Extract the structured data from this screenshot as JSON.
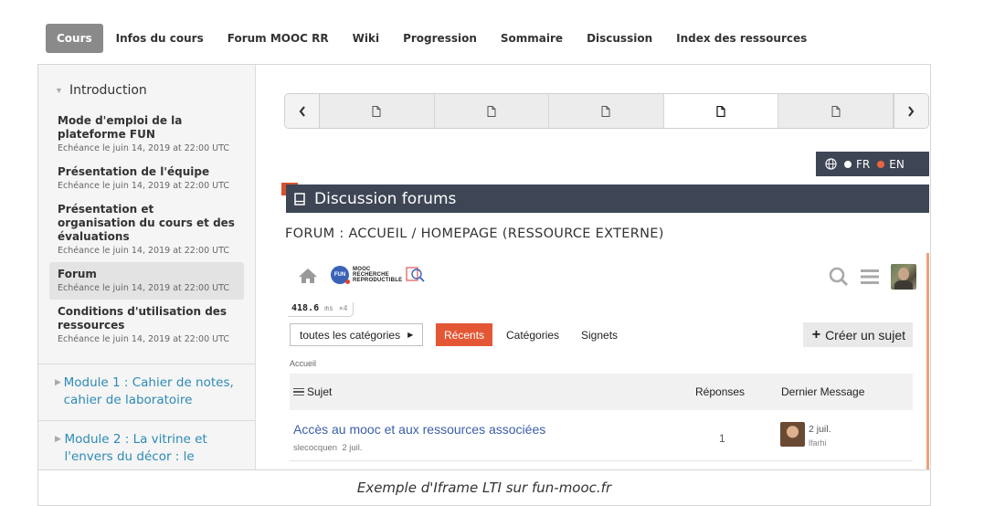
{
  "nav": {
    "tabs": [
      {
        "label": "Cours"
      },
      {
        "label": "Infos du cours"
      },
      {
        "label": "Forum MOOC RR"
      },
      {
        "label": "Wiki"
      },
      {
        "label": "Progression"
      },
      {
        "label": "Sommaire"
      },
      {
        "label": "Discussion"
      },
      {
        "label": "Index des ressources"
      }
    ],
    "active_tab": "Cours"
  },
  "sidebar": {
    "chapter": "Introduction",
    "sequences": [
      {
        "name": "Mode d'emploi de la plateforme FUN",
        "due": "Echéance le juin 14, 2019 at 22:00 UTC"
      },
      {
        "name": "Présentation de l'équipe",
        "due": "Echéance le juin 14, 2019 at 22:00 UTC"
      },
      {
        "name": "Présentation et organisation du cours et des évaluations",
        "due": "Echéance le juin 14, 2019 at 22:00 UTC"
      },
      {
        "name": "Forum",
        "due": "Echéance le juin 14, 2019 at 22:00 UTC"
      },
      {
        "name": "Conditions d'utilisation des ressources",
        "due": "Echéance le juin 14, 2019 at 22:00 UTC"
      }
    ],
    "active_sequence": "Forum",
    "modules": [
      {
        "title": "Module 1 : Cahier de notes, cahier de laboratoire"
      },
      {
        "title": "Module 2 : La vitrine et l'envers du décor : le"
      }
    ]
  },
  "sequence_nav": {
    "unit_count": 5,
    "current_unit": 4
  },
  "language": {
    "fr": "FR",
    "en": "EN",
    "selected": "EN",
    "colors": {
      "bar": "#3e4655",
      "fr_dot": "#ffffff",
      "en_dot": "#e8663f"
    }
  },
  "unit": {
    "title": "Discussion forums",
    "subtitle": "FORUM : ACCUEIL / HOMEPAGE (RESSOURCE EXTERNE)"
  },
  "forum": {
    "logo_text": [
      "MOOC",
      "RECHERCHE",
      "REPRODUCTIBLE"
    ],
    "logo_badge": "FUN",
    "timing_value": "418.6",
    "timing_unit": "ms",
    "timing_mult": "×4",
    "category_button": "toutes les catégories",
    "tabs": [
      "Récents",
      "Catégories",
      "Signets"
    ],
    "create_button": "Créer un sujet",
    "breadcrumb": "Accueil",
    "columns": {
      "topic": "Sujet",
      "replies": "Réponses",
      "last": "Dernier Message"
    },
    "topics": [
      {
        "title": "Accès au mooc et aux ressources associées",
        "author": "slecocquen",
        "date": "2 juil.",
        "replies": "1",
        "last_date": "2 juil.",
        "last_user": "lfarhi"
      }
    ],
    "accent_color": "#e45735"
  },
  "caption": "Exemple d'Iframe LTI sur fun-mooc.fr"
}
